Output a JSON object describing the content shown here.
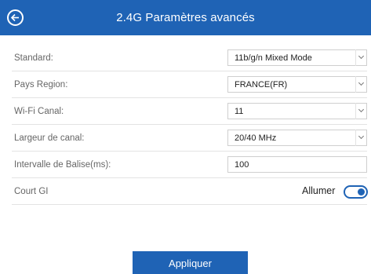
{
  "header": {
    "title": "2.4G Paramètres avancés",
    "back_icon": "back-arrow-circle-icon"
  },
  "settings": {
    "standard": {
      "label": "Standard:",
      "value": "11b/g/n Mixed Mode"
    },
    "region": {
      "label": "Pays Region:",
      "value": "FRANCE(FR)"
    },
    "channel": {
      "label": "Wi-Fi Canal:",
      "value": "11"
    },
    "bandwidth": {
      "label": "Largeur de canal:",
      "value": "20/40 MHz"
    },
    "beacon": {
      "label": "Intervalle de Balise(ms):",
      "value": "100"
    },
    "short_gi": {
      "label": "Court GI",
      "toggle_text": "Allumer",
      "enabled": true
    }
  },
  "footer": {
    "apply_label": "Appliquer"
  },
  "colors": {
    "accent": "#1f63b5"
  }
}
